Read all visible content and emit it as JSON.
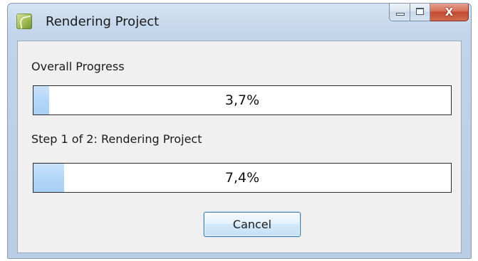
{
  "window": {
    "title": "Rendering Project",
    "icon": "app-icon",
    "caption_buttons": {
      "minimize_icon": "minimize-icon",
      "maximize_icon": "maximize-icon",
      "close_icon": "close-icon",
      "close_glyph": "X"
    }
  },
  "overall": {
    "label": "Overall Progress",
    "value_text": "3,7%",
    "fraction": 0.037
  },
  "step": {
    "label": "Step 1 of 2: Rendering Project",
    "value_text": "7,4%",
    "fraction": 0.074
  },
  "cancel_label": "Cancel",
  "colors": {
    "progress_fill": "#b3d6f7",
    "close_button": "#c24a30",
    "client_background": "#f0f0f0"
  }
}
